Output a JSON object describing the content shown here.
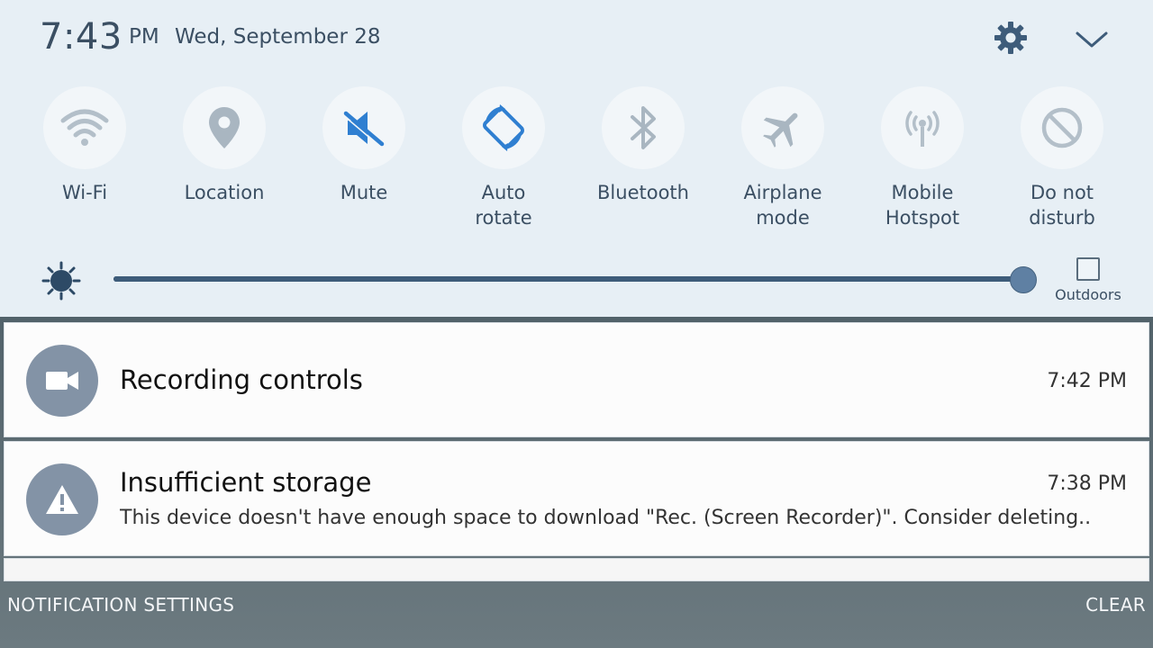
{
  "status": {
    "time": "7:43",
    "ampm": "PM",
    "date": "Wed, September 28"
  },
  "header_icons": {
    "settings": "gear-icon",
    "expand": "chevron-down-icon"
  },
  "tiles": [
    {
      "label": "Wi-Fi",
      "icon": "wifi-icon",
      "active": false
    },
    {
      "label": "Location",
      "icon": "location-icon",
      "active": false
    },
    {
      "label": "Mute",
      "icon": "mute-icon",
      "active": true
    },
    {
      "label": "Auto\nrotate",
      "line1": "Auto",
      "line2": "rotate",
      "icon": "auto-rotate-icon",
      "active": true
    },
    {
      "label": "Bluetooth",
      "icon": "bluetooth-icon",
      "active": false
    },
    {
      "label": "Airplane\nmode",
      "line1": "Airplane",
      "line2": "mode",
      "icon": "airplane-icon",
      "active": false
    },
    {
      "label": "Mobile\nHotspot",
      "line1": "Mobile",
      "line2": "Hotspot",
      "icon": "hotspot-icon",
      "active": false
    },
    {
      "label": "Do not\ndisturb",
      "line1": "Do not",
      "line2": "disturb",
      "icon": "do-not-disturb-icon",
      "active": false
    }
  ],
  "brightness": {
    "level": 1.0,
    "outdoors_label": "Outdoors",
    "outdoors_checked": false
  },
  "notifications": [
    {
      "title": "Recording controls",
      "time": "7:42 PM",
      "icon": "video-camera-icon"
    },
    {
      "title": "Insufficient storage",
      "time": "7:38 PM",
      "body": "This device doesn't have enough space to download \"Rec. (Screen Recorder)\". Consider deleting..",
      "icon": "warning-icon"
    }
  ],
  "footer": {
    "notification_settings": "NOTIFICATION SETTINGS",
    "clear": "CLEAR"
  },
  "colors": {
    "panel_bg": "#e7eff5",
    "text_primary": "#3b4f63",
    "accent_active": "#2f7fd1",
    "inactive_icon": "#a9b6c1",
    "notif_icon_bg": "#8393a6"
  }
}
